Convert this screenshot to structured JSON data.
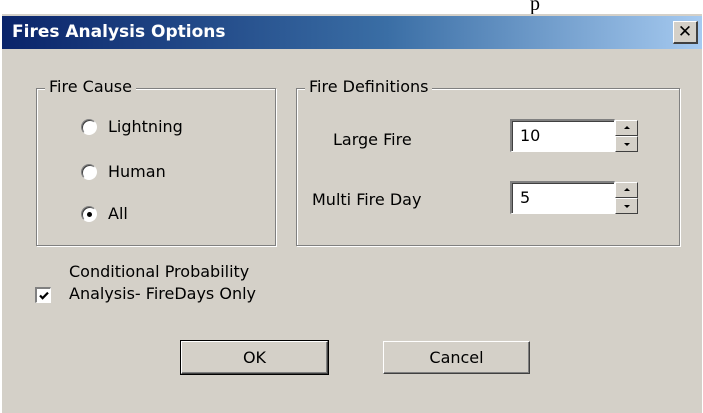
{
  "window": {
    "title": "Fires Analysis Options",
    "close_label": "✕",
    "top_fragment": "p"
  },
  "fire_cause": {
    "legend": "Fire Cause",
    "options": [
      {
        "label": "Lightning",
        "selected": false
      },
      {
        "label": "Human",
        "selected": false
      },
      {
        "label": "All",
        "selected": true
      }
    ]
  },
  "fire_definitions": {
    "legend": "Fire Definitions",
    "large_fire": {
      "label": "Large Fire",
      "value": "10"
    },
    "multi_fire_day": {
      "label": "Multi Fire Day",
      "value": "5"
    }
  },
  "conditional": {
    "line1": "Conditional Probability",
    "line2": "Analysis- FireDays Only",
    "checked": true
  },
  "buttons": {
    "ok": "OK",
    "cancel": "Cancel"
  },
  "colors": {
    "dialog_bg": "#d4d0c8",
    "title_start": "#0a246a",
    "title_end": "#a6caf0"
  }
}
